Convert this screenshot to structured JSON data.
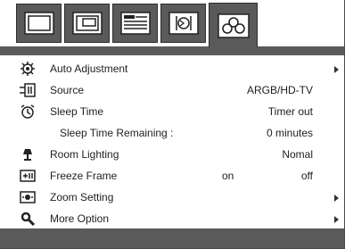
{
  "tabs": [
    {
      "icon": "picture-tab-icon"
    },
    {
      "icon": "pip-tab-icon"
    },
    {
      "icon": "menu-list-tab-icon"
    },
    {
      "icon": "sound-tab-icon"
    },
    {
      "icon": "function-tab-icon",
      "active": true
    }
  ],
  "menu": {
    "auto_adjustment": {
      "label": "Auto Adjustment",
      "icon": "auto-adjust-icon"
    },
    "source": {
      "label": "Source",
      "value": "ARGB/HD-TV",
      "icon": "source-icon"
    },
    "sleep_time": {
      "label": "Sleep Time",
      "value": "Timer out",
      "icon": "sleep-clock-icon"
    },
    "sleep_remaining": {
      "label": "Sleep Time Remaining :",
      "value": "0 minutes"
    },
    "room_lighting": {
      "label": "Room Lighting",
      "value": "Nomal",
      "icon": "lamp-icon"
    },
    "freeze_frame": {
      "label": "Freeze Frame",
      "on": "on",
      "off": "off",
      "icon": "freeze-frame-icon"
    },
    "zoom_setting": {
      "label": "Zoom Setting",
      "icon": "zoom-icon"
    },
    "more_option": {
      "label": "More Option",
      "icon": "more-option-icon"
    }
  },
  "colors": {
    "panel": "#5a5a5a",
    "background": "#ffffff",
    "text": "#1e1e1e"
  }
}
